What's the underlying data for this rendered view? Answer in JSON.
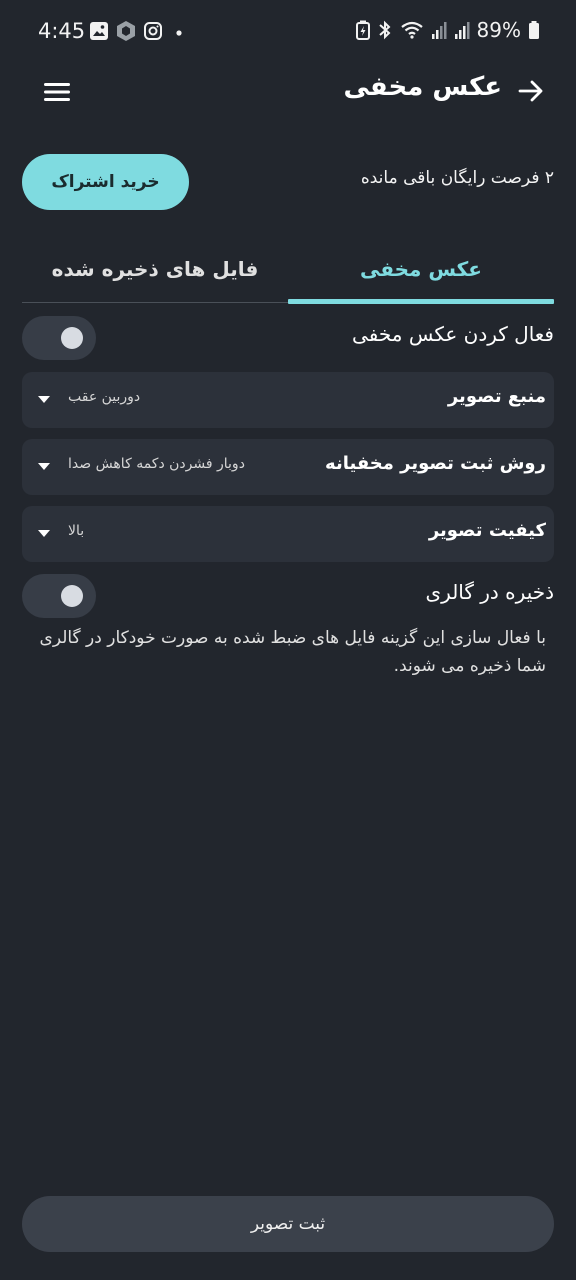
{
  "status_bar": {
    "time": "4:45",
    "battery": "89%",
    "left_icons": [
      "gallery-icon",
      "app-hex-icon",
      "instagram-icon",
      "dot-icon"
    ],
    "right_icons": [
      "battery-saver-icon",
      "bluetooth-icon",
      "wifi-icon",
      "signal-icon",
      "signal-icon",
      "battery-icon"
    ]
  },
  "header": {
    "title": "عکس مخفی"
  },
  "subscription": {
    "button_label": "خرید اشتراک",
    "remaining_text": "۲ فرصت رایگان باقی مانده"
  },
  "tabs": [
    {
      "label": "عکس مخفی",
      "active": true
    },
    {
      "label": "فایل های ذخیره شده",
      "active": false
    }
  ],
  "settings": {
    "enable_label": "فعال کردن عکس مخفی",
    "source": {
      "label": "منبع تصویر",
      "value": "دوربین عقب"
    },
    "method": {
      "label": "روش ثبت تصویر مخفیانه",
      "value": "دوبار فشردن دکمه کاهش صدا"
    },
    "quality": {
      "label": "کیفیت تصویر",
      "value": "بالا"
    },
    "gallery_label": "ذخیره در گالری",
    "gallery_desc": "با فعال سازی این گزینه فایل های ضبط شده به صورت خودکار در گالری شما ذخیره می شوند."
  },
  "capture_button": "ثبت تصویر",
  "colors": {
    "background": "#22262d",
    "accent": "#7fdbe0",
    "card": "#2c313a"
  }
}
